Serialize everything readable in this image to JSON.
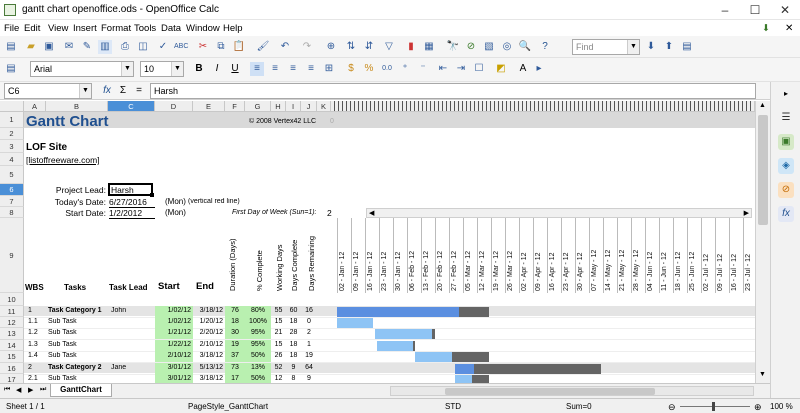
{
  "window": {
    "title": "gantt chart openoffice.ods - OpenOffice Calc",
    "min": "–",
    "max": "☐",
    "close": "✕"
  },
  "menu": [
    "File",
    "Edit",
    "View",
    "Insert",
    "Format",
    "Tools",
    "Data",
    "Window",
    "Help"
  ],
  "toolbar": {
    "find_placeholder": "Find"
  },
  "format": {
    "font": "Arial",
    "size": "10"
  },
  "formula": {
    "cellref": "C6",
    "fx": "fx",
    "sigma": "Σ",
    "eq": "=",
    "content": "Harsh"
  },
  "columns": [
    "A",
    "B",
    "C",
    "D",
    "E",
    "F",
    "G",
    "H",
    "I",
    "J",
    "K"
  ],
  "rows": [
    "1",
    "2",
    "3",
    "4",
    "5",
    "6",
    "7",
    "8",
    "9",
    "10",
    "11",
    "12",
    "13",
    "14",
    "15",
    "16",
    "17"
  ],
  "sheet": {
    "title": "Gantt Chart",
    "copyright": "© 2008 Vertex42 LLC",
    "zero": "0",
    "site": "LOF Site",
    "site_link": "[listoffreeware.com]",
    "lead_label": "Project Lead:",
    "lead": "Harsh",
    "today_label": "Today's Date:",
    "today": "6/27/2016",
    "today_day": "(Mon)",
    "today_note": "(vertical red line)",
    "start_label": "Start Date:",
    "start": "1/2/2012",
    "start_day": "(Mon)",
    "fdow_label": "First Day of Week (Sun=1):",
    "fdow": "2",
    "headers": {
      "wbs": "WBS",
      "tasks": "Tasks",
      "lead": "Task Lead",
      "start": "Start",
      "end": "End",
      "duration": "Duration (Days)",
      "pct": "% Complete",
      "working": "Working Days",
      "complete": "Days Complete",
      "remaining": "Days Remaining"
    },
    "dates": [
      "02 - Jan - 12",
      "09 - Jan - 12",
      "16 - Jan - 12",
      "23 - Jan - 12",
      "30 - Jan - 12",
      "06 - Feb - 12",
      "13 - Feb - 12",
      "20 - Feb - 12",
      "27 - Feb - 12",
      "05 - Mar - 12",
      "12 - Mar - 12",
      "19 - Mar - 12",
      "26 - Mar - 12",
      "02 - Apr - 12",
      "09 - Apr - 12",
      "16 - Apr - 12",
      "23 - Apr - 12",
      "30 - Apr - 12",
      "07 - May - 12",
      "14 - May - 12",
      "21 - May - 12",
      "28 - May - 12",
      "04 - Jun - 12",
      "11 - Jun - 12",
      "18 - Jun - 12",
      "25 - Jun - 12",
      "02 - Jul - 12",
      "09 - Jul - 12",
      "16 - Jul - 12",
      "23 - Jul - 12"
    ],
    "tasks": [
      {
        "wbs": "1",
        "name": "Task Category 1",
        "lead": "John",
        "start": "1/02/12",
        "end": "3/18/12",
        "dur": "76",
        "pct": "80%",
        "work": "55",
        "comp": "60",
        "rem": "16",
        "cat": true
      },
      {
        "wbs": "1.1",
        "name": "Sub Task",
        "lead": "",
        "start": "1/02/12",
        "end": "1/20/12",
        "dur": "18",
        "pct": "100%",
        "work": "15",
        "comp": "18",
        "rem": "0",
        "cat": false
      },
      {
        "wbs": "1.2",
        "name": "Sub Task",
        "lead": "",
        "start": "1/21/12",
        "end": "2/20/12",
        "dur": "30",
        "pct": "95%",
        "work": "21",
        "comp": "28",
        "rem": "2",
        "cat": false
      },
      {
        "wbs": "1.3",
        "name": "Sub Task",
        "lead": "",
        "start": "1/22/12",
        "end": "2/10/12",
        "dur": "19",
        "pct": "95%",
        "work": "15",
        "comp": "18",
        "rem": "1",
        "cat": false
      },
      {
        "wbs": "1.4",
        "name": "Sub Task",
        "lead": "",
        "start": "2/10/12",
        "end": "3/18/12",
        "dur": "37",
        "pct": "50%",
        "work": "26",
        "comp": "18",
        "rem": "19",
        "cat": false
      },
      {
        "wbs": "2",
        "name": "Task Category 2",
        "lead": "Jane",
        "start": "3/01/12",
        "end": "5/13/12",
        "dur": "73",
        "pct": "13%",
        "work": "52",
        "comp": "9",
        "rem": "64",
        "cat": true
      },
      {
        "wbs": "2.1",
        "name": "Sub Task",
        "lead": "",
        "start": "3/01/12",
        "end": "3/18/12",
        "dur": "17",
        "pct": "50%",
        "work": "12",
        "comp": "8",
        "rem": "9",
        "cat": false
      }
    ]
  },
  "tab": "GanttChart",
  "status": {
    "sheet": "Sheet 1 / 1",
    "style": "PageStyle_GanttChart",
    "mode": "STD",
    "sum": "Sum=0",
    "zoom": "100 %"
  },
  "colors": {
    "selected": "#4a8fd7",
    "done_category": "#5b8fe0",
    "done_sub": "#8ec4f5",
    "remaining": "#646464",
    "green": "#b9f0b0",
    "title": "#1f4f8f"
  }
}
